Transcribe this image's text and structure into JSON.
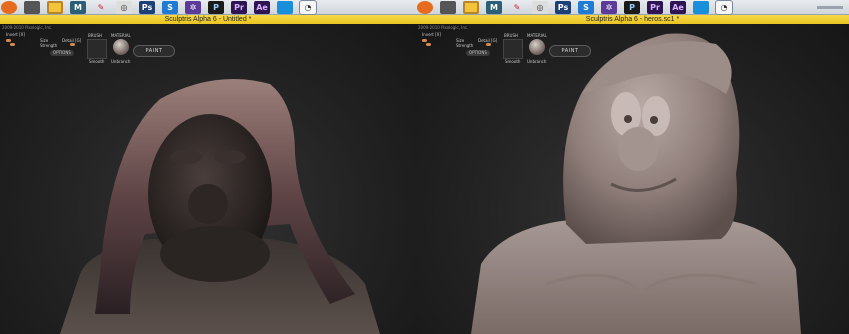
{
  "panels": [
    {
      "title": "Sculptris Alpha 6 - Untitled *",
      "copyright": "2009-2010 Pixologic, Inc.",
      "tools": {
        "invert": "Invert [X]",
        "size": "Size",
        "strength": "Strength",
        "detail": "Detail [G]",
        "options": "OPTIONS",
        "brush_label": "BRUSH",
        "material_label": "MATERIAL",
        "brush_name": "Smooth",
        "material_name": "Unbranch",
        "paint": "PAINT"
      },
      "accent": "#f0d33a"
    },
    {
      "title": "Sculptris Alpha 6 - heros.sc1 *",
      "copyright": "2009-2010 Pixologic, Inc.",
      "tools": {
        "invert": "Invert [X]",
        "size": "Size",
        "strength": "Strength",
        "detail": "Detail [G]",
        "options": "OPTIONS",
        "brush_label": "BRUSH",
        "material_label": "MATERIAL",
        "brush_name": "Smooth",
        "material_name": "Unbranch",
        "paint": "PAINT"
      },
      "accent": "#f0d33a"
    }
  ],
  "taskbar_icons": [
    "firefox-icon",
    "storage-icon",
    "folder-icon",
    "maya-m-icon",
    "pencil-app-icon",
    "browser-globe-icon",
    "photoshop-icon",
    "sculptris-s-icon",
    "settings-gear-icon",
    "premiere-pr-icon",
    "premiere-icon",
    "after-effects-icon",
    "window-icon",
    "sculptris-active-icon"
  ]
}
